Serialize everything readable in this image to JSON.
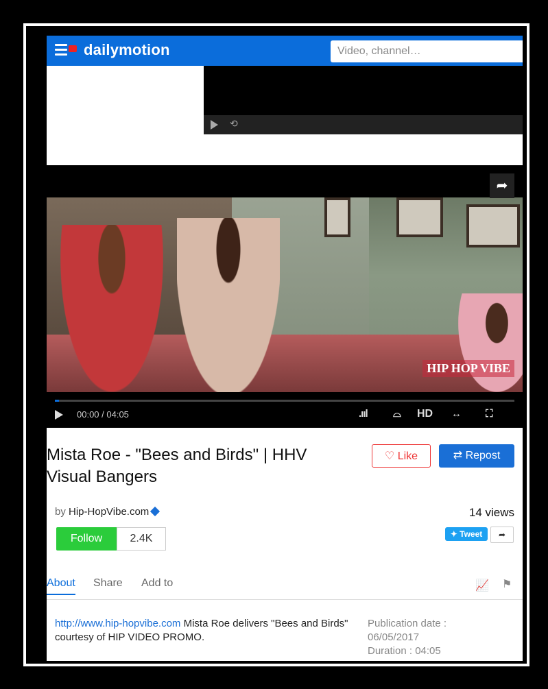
{
  "header": {
    "brand": "dailymotion",
    "search_placeholder": "Video, channel…"
  },
  "player": {
    "time_display": "00:00 / 04:05",
    "progress_fraction": 0.0,
    "quality_label": "HD",
    "watermark": "HIP HOP VIBE"
  },
  "video": {
    "title": "Mista Roe - \"Bees and Birds\" | HHV Visual Bangers",
    "like_label": "Like",
    "repost_label": "Repost",
    "by_prefix": "by",
    "channel": "Hip-HopVibe.com",
    "views": "14 views",
    "follow_label": "Follow",
    "follower_count": "2.4K",
    "tweet_label": "Tweet"
  },
  "tabs": [
    "About",
    "Share",
    "Add to"
  ],
  "about": {
    "link": "http://www.hip-hopvibe.com",
    "description": " Mista Roe delivers \"Bees and Birds\" courtesy of HIP VIDEO PROMO.",
    "publication_label": "Publication date :",
    "publication_date": "06/05/2017",
    "duration": "Duration : 04:05"
  },
  "colors": {
    "brand_blue": "#0b6ddb",
    "follow_green": "#2bcc3b",
    "like_red": "#e33333"
  }
}
